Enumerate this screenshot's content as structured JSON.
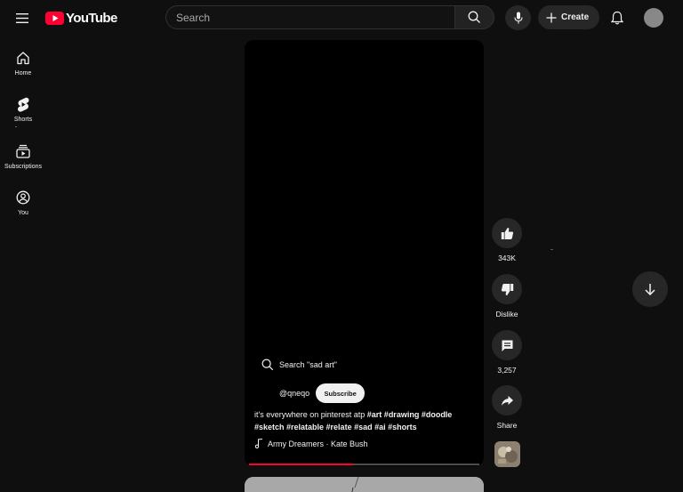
{
  "header": {
    "logo_text": "YouTube",
    "search_placeholder": "Search",
    "create_label": "Create"
  },
  "sidebar": {
    "items": [
      {
        "label": "Home",
        "icon": "home-icon"
      },
      {
        "label": "Shorts",
        "icon": "shorts-icon"
      },
      {
        "label": "Subscriptions",
        "icon": "subscriptions-icon"
      },
      {
        "label": "You",
        "icon": "you-icon"
      }
    ]
  },
  "short": {
    "search_suggestion": "Search \"sad art\"",
    "channel_handle": "@qneqo",
    "subscribe_label": "Subscribe",
    "description_text": "it's everywhere on pinterest atp ",
    "description_tags": "#art #drawing #doodle #sketch #relatable #relate #sad #ai #shorts",
    "music": "Army Dreamers · Kate Bush",
    "progress_fraction": 0.45
  },
  "actions": {
    "like_count": "343K",
    "dislike_label": "Dislike",
    "comment_count": "3,257",
    "share_label": "Share"
  },
  "colors": {
    "brand_red": "#ff0033",
    "background": "#0f0f0f",
    "button_bg": "#272727"
  }
}
